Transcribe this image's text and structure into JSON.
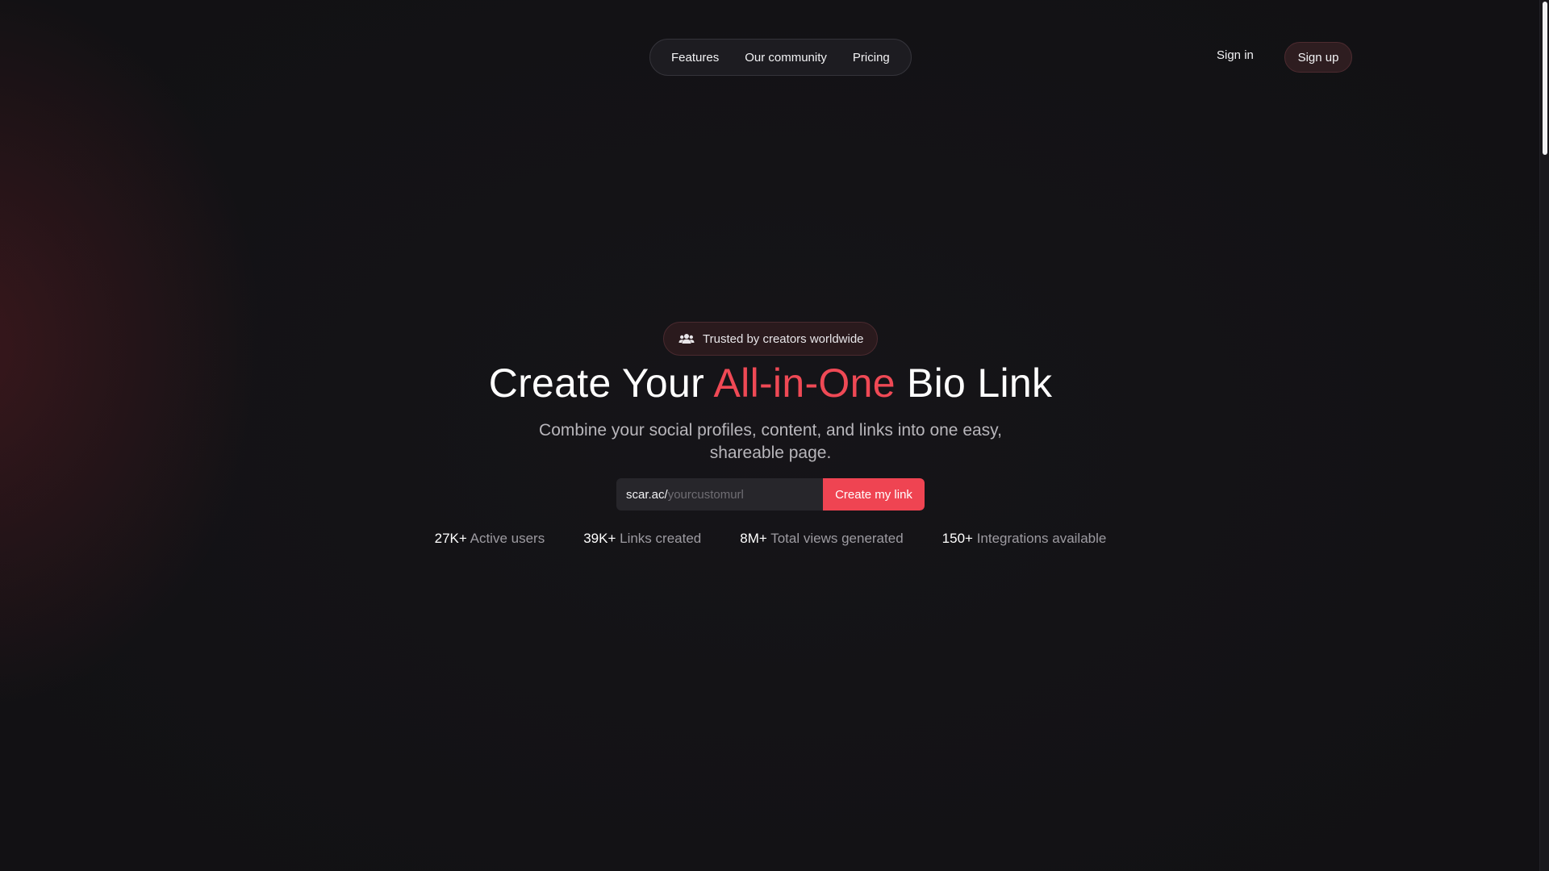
{
  "nav": {
    "links": [
      {
        "label": "Features"
      },
      {
        "label": "Our community"
      },
      {
        "label": "Pricing"
      }
    ],
    "sign_in": "Sign in",
    "sign_up": "Sign up"
  },
  "hero": {
    "badge": {
      "icon": "users-icon",
      "text": "Trusted by creators worldwide"
    },
    "title": {
      "before": "Create Your ",
      "accent": "All-in-One",
      "after": " Bio Link"
    },
    "subtitle": "Combine your social profiles, content, and links into one easy, shareable page.",
    "form": {
      "prefix": "scar.ac/",
      "placeholder": "yourcustomurl",
      "value": "",
      "button": "Create my link"
    },
    "stats": [
      {
        "value": "27K+",
        "label": "Active users"
      },
      {
        "value": "39K+",
        "label": "Links created"
      },
      {
        "value": "8M+",
        "label": "Total views generated"
      },
      {
        "value": "150+",
        "label": "Integrations available"
      }
    ]
  },
  "colors": {
    "background": "#121114",
    "accent": "#ef4955",
    "button": "#ef4452",
    "muted_text": "#9d9ba1"
  }
}
